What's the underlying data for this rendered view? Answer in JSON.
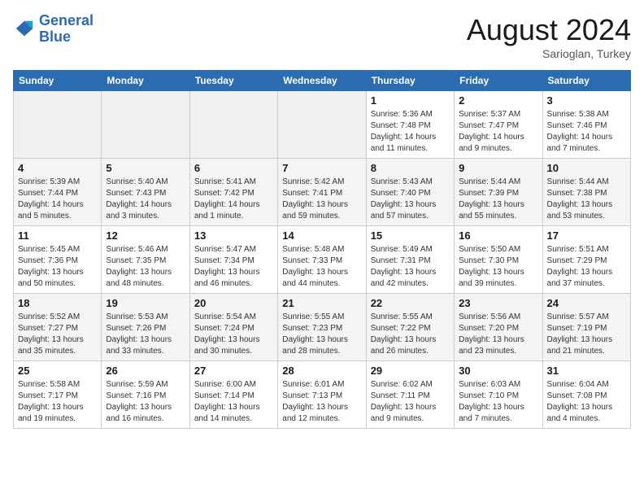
{
  "header": {
    "logo_line1": "General",
    "logo_line2": "Blue",
    "month": "August 2024",
    "location": "Sarioglan, Turkey"
  },
  "weekdays": [
    "Sunday",
    "Monday",
    "Tuesday",
    "Wednesday",
    "Thursday",
    "Friday",
    "Saturday"
  ],
  "weeks": [
    [
      {
        "day": "",
        "info": ""
      },
      {
        "day": "",
        "info": ""
      },
      {
        "day": "",
        "info": ""
      },
      {
        "day": "",
        "info": ""
      },
      {
        "day": "1",
        "info": "Sunrise: 5:36 AM\nSunset: 7:48 PM\nDaylight: 14 hours\nand 11 minutes."
      },
      {
        "day": "2",
        "info": "Sunrise: 5:37 AM\nSunset: 7:47 PM\nDaylight: 14 hours\nand 9 minutes."
      },
      {
        "day": "3",
        "info": "Sunrise: 5:38 AM\nSunset: 7:46 PM\nDaylight: 14 hours\nand 7 minutes."
      }
    ],
    [
      {
        "day": "4",
        "info": "Sunrise: 5:39 AM\nSunset: 7:44 PM\nDaylight: 14 hours\nand 5 minutes."
      },
      {
        "day": "5",
        "info": "Sunrise: 5:40 AM\nSunset: 7:43 PM\nDaylight: 14 hours\nand 3 minutes."
      },
      {
        "day": "6",
        "info": "Sunrise: 5:41 AM\nSunset: 7:42 PM\nDaylight: 14 hours\nand 1 minute."
      },
      {
        "day": "7",
        "info": "Sunrise: 5:42 AM\nSunset: 7:41 PM\nDaylight: 13 hours\nand 59 minutes."
      },
      {
        "day": "8",
        "info": "Sunrise: 5:43 AM\nSunset: 7:40 PM\nDaylight: 13 hours\nand 57 minutes."
      },
      {
        "day": "9",
        "info": "Sunrise: 5:44 AM\nSunset: 7:39 PM\nDaylight: 13 hours\nand 55 minutes."
      },
      {
        "day": "10",
        "info": "Sunrise: 5:44 AM\nSunset: 7:38 PM\nDaylight: 13 hours\nand 53 minutes."
      }
    ],
    [
      {
        "day": "11",
        "info": "Sunrise: 5:45 AM\nSunset: 7:36 PM\nDaylight: 13 hours\nand 50 minutes."
      },
      {
        "day": "12",
        "info": "Sunrise: 5:46 AM\nSunset: 7:35 PM\nDaylight: 13 hours\nand 48 minutes."
      },
      {
        "day": "13",
        "info": "Sunrise: 5:47 AM\nSunset: 7:34 PM\nDaylight: 13 hours\nand 46 minutes."
      },
      {
        "day": "14",
        "info": "Sunrise: 5:48 AM\nSunset: 7:33 PM\nDaylight: 13 hours\nand 44 minutes."
      },
      {
        "day": "15",
        "info": "Sunrise: 5:49 AM\nSunset: 7:31 PM\nDaylight: 13 hours\nand 42 minutes."
      },
      {
        "day": "16",
        "info": "Sunrise: 5:50 AM\nSunset: 7:30 PM\nDaylight: 13 hours\nand 39 minutes."
      },
      {
        "day": "17",
        "info": "Sunrise: 5:51 AM\nSunset: 7:29 PM\nDaylight: 13 hours\nand 37 minutes."
      }
    ],
    [
      {
        "day": "18",
        "info": "Sunrise: 5:52 AM\nSunset: 7:27 PM\nDaylight: 13 hours\nand 35 minutes."
      },
      {
        "day": "19",
        "info": "Sunrise: 5:53 AM\nSunset: 7:26 PM\nDaylight: 13 hours\nand 33 minutes."
      },
      {
        "day": "20",
        "info": "Sunrise: 5:54 AM\nSunset: 7:24 PM\nDaylight: 13 hours\nand 30 minutes."
      },
      {
        "day": "21",
        "info": "Sunrise: 5:55 AM\nSunset: 7:23 PM\nDaylight: 13 hours\nand 28 minutes."
      },
      {
        "day": "22",
        "info": "Sunrise: 5:55 AM\nSunset: 7:22 PM\nDaylight: 13 hours\nand 26 minutes."
      },
      {
        "day": "23",
        "info": "Sunrise: 5:56 AM\nSunset: 7:20 PM\nDaylight: 13 hours\nand 23 minutes."
      },
      {
        "day": "24",
        "info": "Sunrise: 5:57 AM\nSunset: 7:19 PM\nDaylight: 13 hours\nand 21 minutes."
      }
    ],
    [
      {
        "day": "25",
        "info": "Sunrise: 5:58 AM\nSunset: 7:17 PM\nDaylight: 13 hours\nand 19 minutes."
      },
      {
        "day": "26",
        "info": "Sunrise: 5:59 AM\nSunset: 7:16 PM\nDaylight: 13 hours\nand 16 minutes."
      },
      {
        "day": "27",
        "info": "Sunrise: 6:00 AM\nSunset: 7:14 PM\nDaylight: 13 hours\nand 14 minutes."
      },
      {
        "day": "28",
        "info": "Sunrise: 6:01 AM\nSunset: 7:13 PM\nDaylight: 13 hours\nand 12 minutes."
      },
      {
        "day": "29",
        "info": "Sunrise: 6:02 AM\nSunset: 7:11 PM\nDaylight: 13 hours\nand 9 minutes."
      },
      {
        "day": "30",
        "info": "Sunrise: 6:03 AM\nSunset: 7:10 PM\nDaylight: 13 hours\nand 7 minutes."
      },
      {
        "day": "31",
        "info": "Sunrise: 6:04 AM\nSunset: 7:08 PM\nDaylight: 13 hours\nand 4 minutes."
      }
    ]
  ]
}
